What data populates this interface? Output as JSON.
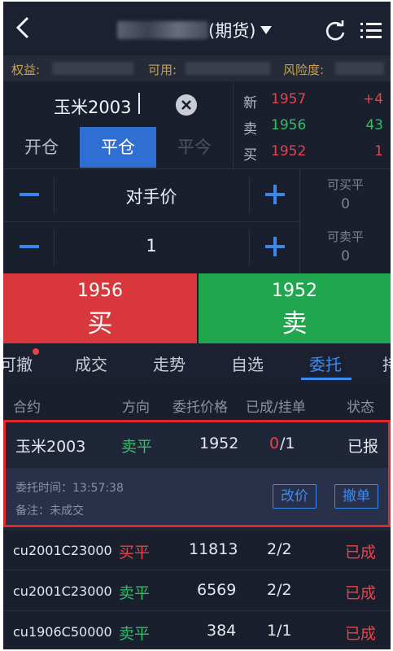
{
  "header": {
    "title": "(期货)"
  },
  "account": {
    "equity_label": "权益:",
    "available_label": "可用:",
    "risk_label": "风险度:"
  },
  "contract": {
    "name": "玉米2003"
  },
  "mode_tabs": [
    "开仓",
    "平仓",
    "平今"
  ],
  "quote": [
    {
      "key": "新",
      "price": "1957",
      "change": "+4"
    },
    {
      "key": "卖",
      "price": "1956",
      "change": "43"
    },
    {
      "key": "买",
      "price": "1952",
      "change": "1"
    }
  ],
  "price_type": "对手价",
  "quantity": "1",
  "available": {
    "buy_close_label": "可买平",
    "buy_close_value": "0",
    "sell_close_label": "可卖平",
    "sell_close_value": "0"
  },
  "buy": {
    "price": "1956",
    "label": "买"
  },
  "sell": {
    "price": "1952",
    "label": "卖"
  },
  "bottom_tabs": [
    "可撤",
    "成交",
    "走势",
    "自选",
    "委托",
    "持"
  ],
  "list_headers": [
    "合约",
    "方向",
    "委托价格",
    "已成/挂单",
    "状态"
  ],
  "selected_order": {
    "contract": "玉米2003",
    "direction": "卖平",
    "price": "1952",
    "filled": "0",
    "total": "/1",
    "status": "已报",
    "time_label": "委托时间：13:57:38",
    "note_label": "备注：未成交",
    "modify_button": "改价",
    "cancel_button": "撤单"
  },
  "orders": [
    {
      "contract": "cu2001C23000",
      "direction": "买平",
      "price": "11813",
      "filled": "2/2",
      "status": "已成"
    },
    {
      "contract": "cu2001C23000",
      "direction": "卖平",
      "price": "6569",
      "filled": "2/2",
      "status": "已成"
    },
    {
      "contract": "cu1906C50000",
      "direction": "卖平",
      "price": "384",
      "filled": "1/1",
      "status": "已成"
    }
  ],
  "colors": {
    "up": "#e8424a",
    "down": "#2fbf64",
    "accent": "#3b8cf2",
    "background": "#1a1f2e"
  }
}
